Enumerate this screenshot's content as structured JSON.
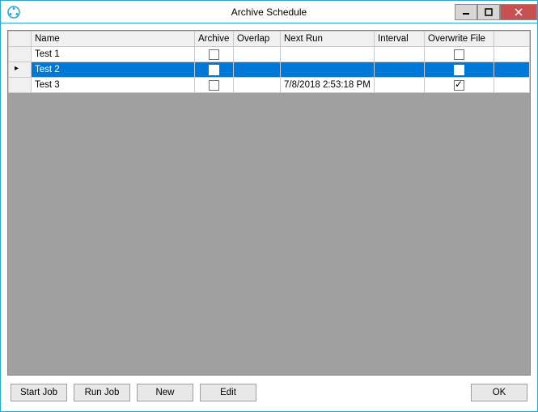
{
  "window": {
    "title": "Archive Schedule"
  },
  "grid": {
    "columns": {
      "name": "Name",
      "archive": "Archive",
      "overlap": "Overlap",
      "nextRun": "Next Run",
      "interval": "Interval",
      "overwrite": "Overwrite File"
    },
    "rows": [
      {
        "name": "Test 1",
        "archive": false,
        "overlap": "",
        "nextRun": "",
        "interval": "",
        "overwrite": false,
        "selected": false
      },
      {
        "name": "Test 2",
        "archive": false,
        "overlap": "",
        "nextRun": "",
        "interval": "",
        "overwrite": false,
        "selected": true
      },
      {
        "name": "Test 3",
        "archive": false,
        "overlap": "",
        "nextRun": "7/8/2018 2:53:18 PM",
        "interval": "",
        "overwrite": true,
        "selected": false
      }
    ]
  },
  "buttons": {
    "startJob": "Start Job",
    "runJob": "Run Job",
    "new": "New",
    "edit": "Edit",
    "ok": "OK"
  }
}
